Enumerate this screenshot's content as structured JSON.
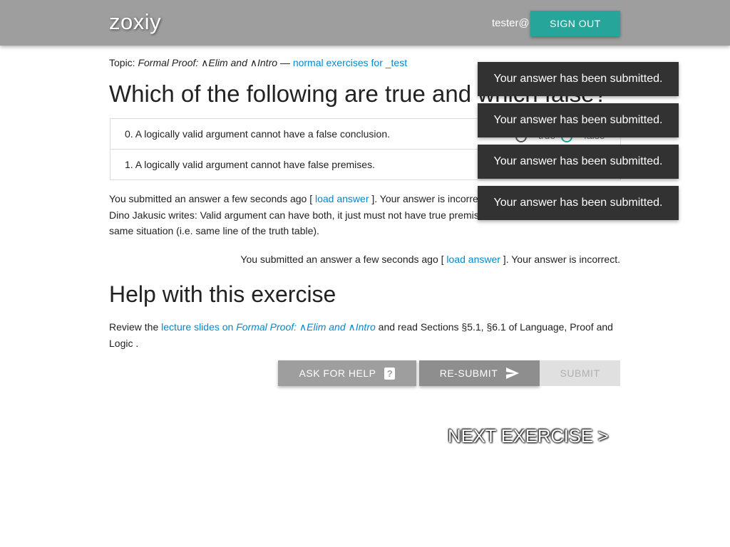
{
  "header": {
    "brand": "zoxiy",
    "user": "tester@",
    "signout_label": "SIGN OUT"
  },
  "topic": {
    "prefix": "Topic: ",
    "name": "Formal Proof: ∧Elim and ∧Intro",
    "dash": " — ",
    "link_label": "normal exercises for _test"
  },
  "question": {
    "title": "Which of the following are true and which false?",
    "rows": [
      {
        "text": "0. A logically valid argument cannot have a false conclusion.",
        "true_label": "true",
        "false_label": "false"
      },
      {
        "text": "1. A logically valid argument cannot have false premises."
      }
    ]
  },
  "feedback1": {
    "prefix": "You submitted an answer a few seconds ago [ ",
    "link": "load answer",
    "suffix": " ]. Your answer is incorrect.",
    "comment": "Dino Jakusic writes: Valid argument can have both, it just must not have true premises and a false conclusion in the same situation (i.e. same line of the truth table)."
  },
  "feedback2": {
    "prefix": "You submitted an answer a few seconds ago [ ",
    "link": "load answer",
    "suffix": " ]. Your answer is incorrect."
  },
  "help": {
    "title": "Help with this exercise",
    "review_prefix": "Review the ",
    "slides_link_prefix": "lecture slides on ",
    "slides_link_topic": "Formal Proof: ∧Elim and ∧Intro",
    "review_suffix": " and read Sections §5.1, §6.1 of Language, Proof and Logic ."
  },
  "buttons": {
    "ask_for_help": "ASK FOR HELP",
    "resubmit": "RE-SUBMIT",
    "submit": "SUBMIT"
  },
  "next_exercise": "NEXT EXERCISE >",
  "toasts": [
    "Your answer has been submitted.",
    "Your answer has been submitted.",
    "Your answer has been submitted.",
    "Your answer has been submitted."
  ],
  "colors": {
    "accent": "#26a69a",
    "link": "#0288d1",
    "toast_bg": "#323232"
  }
}
